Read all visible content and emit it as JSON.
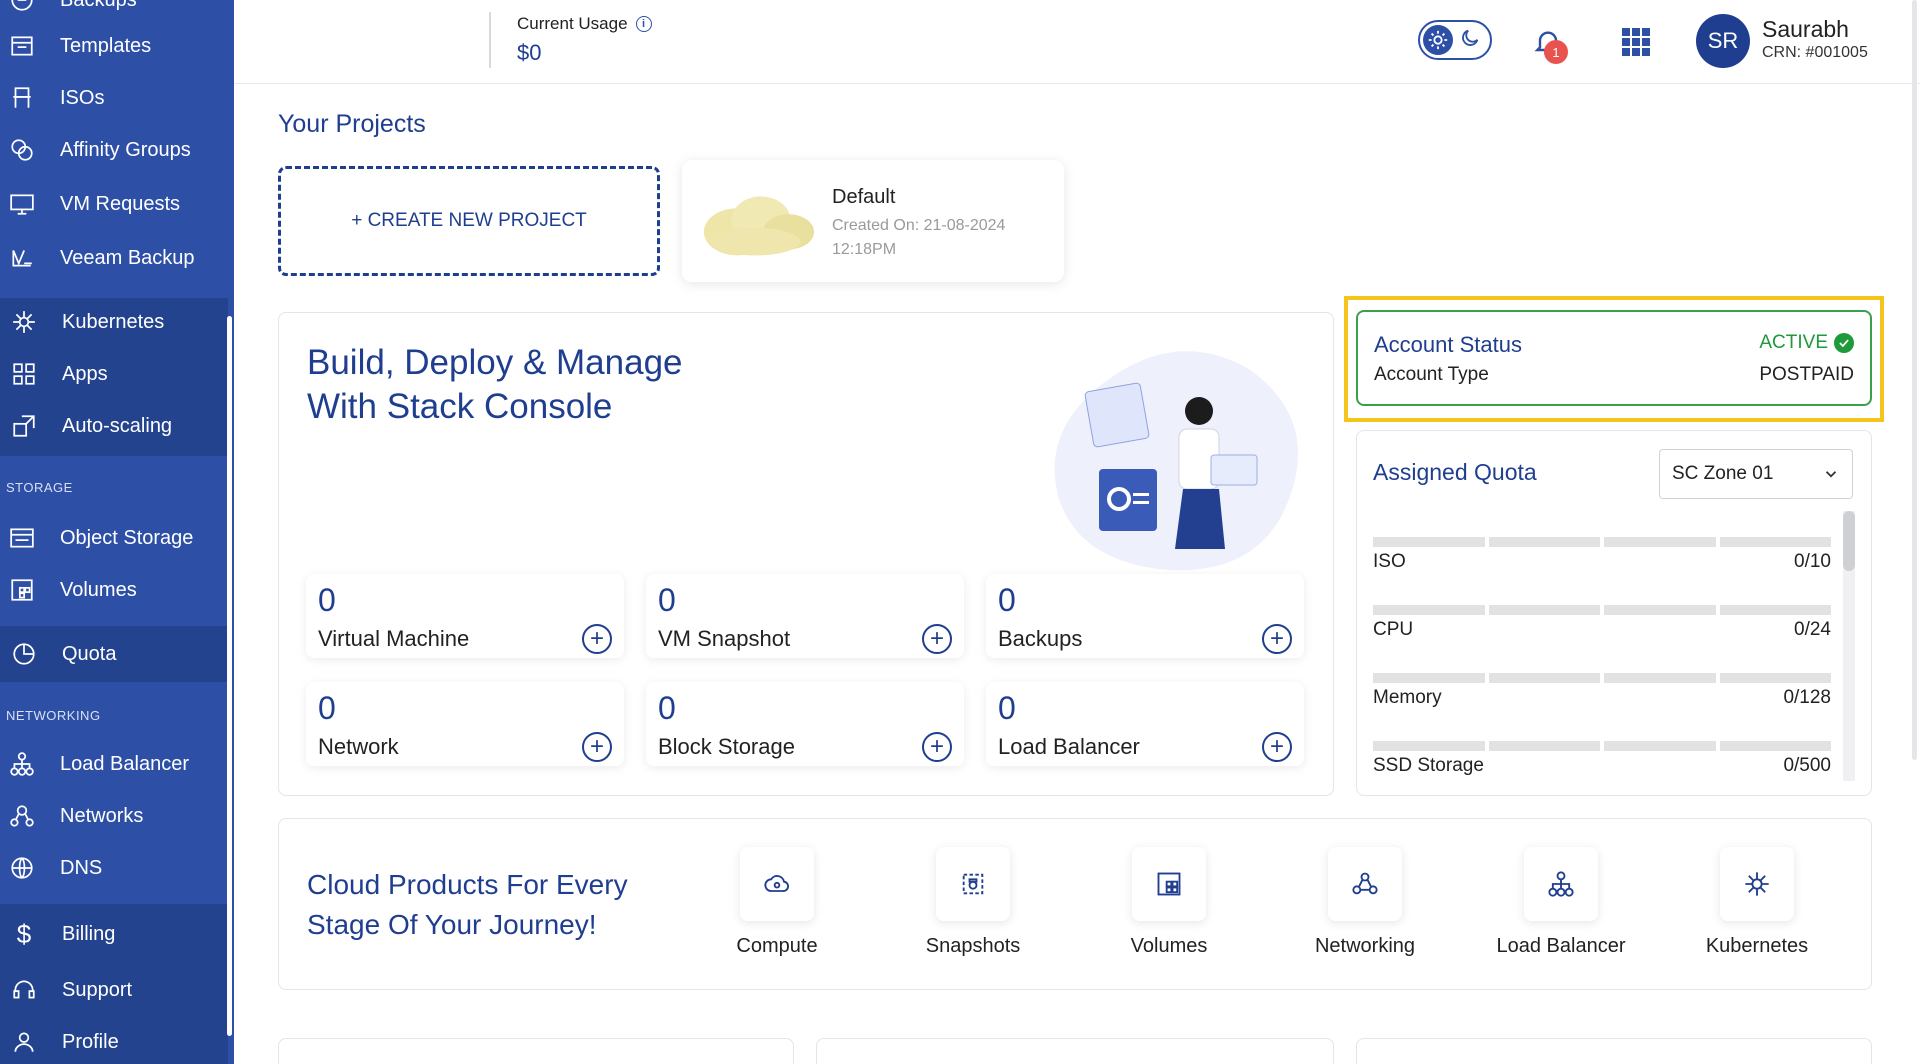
{
  "sidebar": {
    "items": [
      {
        "label": "Backups",
        "icon": "backup-icon"
      },
      {
        "label": "Templates",
        "icon": "templates-icon"
      },
      {
        "label": "ISOs",
        "icon": "iso-icon"
      },
      {
        "label": "Affinity Groups",
        "icon": "affinity-groups-icon"
      },
      {
        "label": "VM Requests",
        "icon": "vm-requests-icon"
      },
      {
        "label": "Veeam Backup",
        "icon": "veeam-icon"
      },
      {
        "label": "Kubernetes",
        "icon": "kubernetes-icon"
      },
      {
        "label": "Apps",
        "icon": "apps-icon"
      },
      {
        "label": "Auto-scaling",
        "icon": "autoscaling-icon"
      },
      {
        "label": "Object Storage",
        "icon": "object-storage-icon"
      },
      {
        "label": "Volumes",
        "icon": "volumes-icon"
      },
      {
        "label": "Quota",
        "icon": "quota-icon"
      },
      {
        "label": "Load Balancer",
        "icon": "load-balancer-icon"
      },
      {
        "label": "Networks",
        "icon": "networks-icon"
      },
      {
        "label": "DNS",
        "icon": "dns-icon"
      },
      {
        "label": "Billing",
        "icon": "dollar-icon"
      },
      {
        "label": "Support",
        "icon": "headset-icon"
      },
      {
        "label": "Profile",
        "icon": "user-icon"
      }
    ],
    "sections": {
      "storage": "STORAGE",
      "networking": "NETWORKING"
    }
  },
  "topbar": {
    "usage_label": "Current Usage",
    "usage_value": "$0",
    "notification_count": "1",
    "user_initials": "SR",
    "user_name": "Saurabh",
    "user_crn": "CRN: #001005"
  },
  "projects": {
    "title": "Your Projects",
    "create_label": "+ CREATE NEW PROJECT",
    "default_name": "Default",
    "default_created": "Created On: 21-08-2024 12:18PM"
  },
  "hero": {
    "title_line1": "Build, Deploy & Manage",
    "title_line2": "With Stack Console"
  },
  "stats": [
    {
      "value": "0",
      "label": "Virtual Machine"
    },
    {
      "value": "0",
      "label": "VM Snapshot"
    },
    {
      "value": "0",
      "label": "Backups"
    },
    {
      "value": "0",
      "label": "Network"
    },
    {
      "value": "0",
      "label": "Block Storage"
    },
    {
      "value": "0",
      "label": "Load Balancer"
    }
  ],
  "account": {
    "status_label": "Account Status",
    "status_value": "ACTIVE",
    "type_label": "Account Type",
    "type_value": "POSTPAID"
  },
  "quota": {
    "title": "Assigned Quota",
    "zone": "SC Zone 01",
    "rows": [
      {
        "label": "ISO",
        "value": "0/10"
      },
      {
        "label": "CPU",
        "value": "0/24"
      },
      {
        "label": "Memory",
        "value": "0/128"
      },
      {
        "label": "SSD Storage",
        "value": "0/500"
      }
    ]
  },
  "products": {
    "title": "Cloud Products For Every Stage Of Your Journey!",
    "items": [
      {
        "label": "Compute",
        "icon": "compute-icon"
      },
      {
        "label": "Snapshots",
        "icon": "snapshot-icon"
      },
      {
        "label": "Volumes",
        "icon": "volumes-icon"
      },
      {
        "label": "Networking",
        "icon": "networking-icon"
      },
      {
        "label": "Load Balancer",
        "icon": "load-balancer-icon"
      },
      {
        "label": "Kubernetes",
        "icon": "kubernetes-icon"
      }
    ]
  },
  "colors": {
    "brand": "#2d4fa6",
    "highlight": "#f5c51e",
    "active": "#1f9a3b",
    "badge": "#e9534f"
  }
}
